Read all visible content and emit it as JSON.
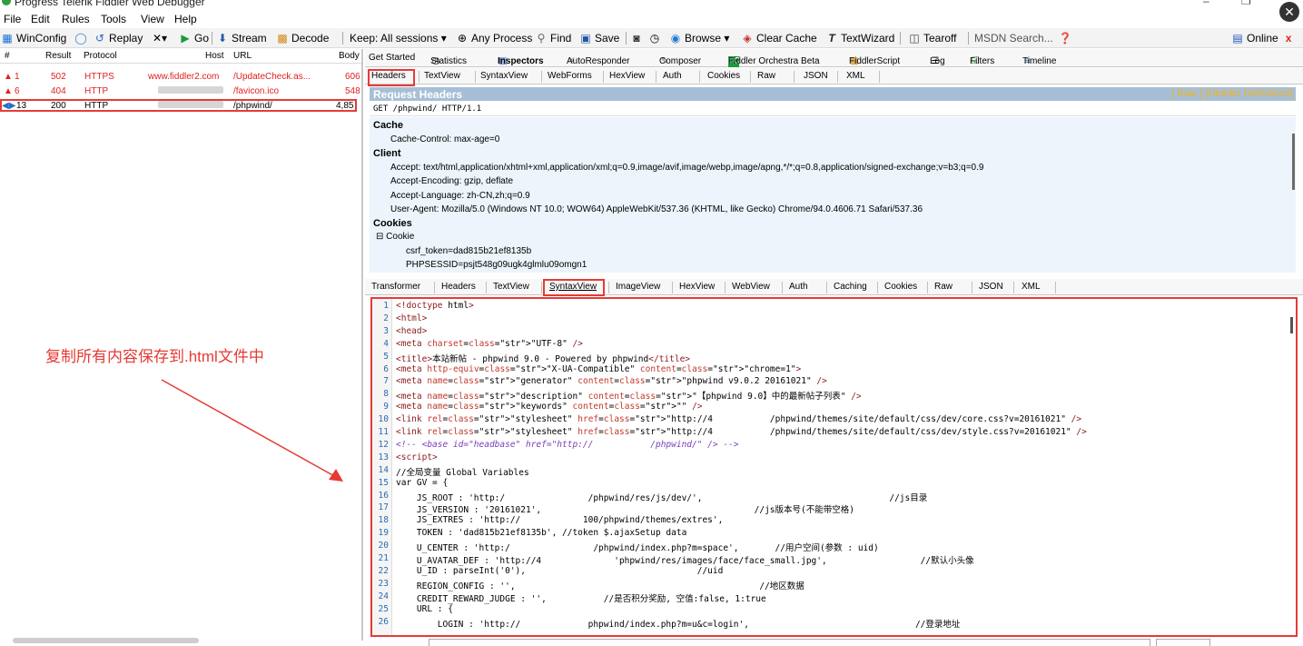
{
  "window": {
    "title": "Progress Telerik Fiddler Web Debugger",
    "close_glyph": "✕"
  },
  "menu": [
    "File",
    "Edit",
    "Rules",
    "Tools",
    "View",
    "Help"
  ],
  "toolbar": {
    "winconfig": "WinConfig",
    "replay": "Replay",
    "remove": "✕▾",
    "go": "Go",
    "stream": "Stream",
    "decode": "Decode",
    "keep": "Keep: All sessions ▾",
    "any_process": "Any Process",
    "find": "Find",
    "save": "Save",
    "browse": "Browse ▾",
    "clear_cache": "Clear Cache",
    "textwizard": "TextWizard",
    "tearoff": "Tearoff",
    "msdn": "MSDN Search...",
    "online": "Online",
    "online_close": "x"
  },
  "sessions": {
    "columns": [
      "#",
      "Result",
      "Protocol",
      "Host",
      "URL",
      "Body"
    ],
    "rows": [
      {
        "id": "1",
        "result": "502",
        "protocol": "HTTPS",
        "host": "www.fiddler2.com",
        "url": "/UpdateCheck.as...",
        "body": "606",
        "status": "error"
      },
      {
        "id": "6",
        "result": "404",
        "protocol": "HTTP",
        "host": "",
        "url": "/favicon.ico",
        "body": "548",
        "status": "error"
      },
      {
        "id": "13",
        "result": "200",
        "protocol": "HTTP",
        "host": "",
        "url": "/phpwind/",
        "body": "4,85",
        "status": "selected"
      }
    ]
  },
  "annotation": "复制所有内容保存到.html文件中",
  "main_tabs": [
    "Get Started",
    "Statistics",
    "Inspectors",
    "AutoResponder",
    "Composer",
    "Fiddler Orchestra Beta",
    "FiddlerScript",
    "Log",
    "Filters",
    "Timeline"
  ],
  "request_tabs": [
    "Headers",
    "TextView",
    "SyntaxView",
    "WebForms",
    "HexView",
    "Auth",
    "Cookies",
    "Raw",
    "JSON",
    "XML"
  ],
  "request_headers": {
    "title": "Request Headers",
    "links": "[ Raw ]   [Header Definitions]",
    "request_line": "GET /phpwind/ HTTP/1.1",
    "groups": [
      {
        "name": "Cache",
        "items": [
          "Cache-Control: max-age=0"
        ]
      },
      {
        "name": "Client",
        "items": [
          "Accept: text/html,application/xhtml+xml,application/xml;q=0.9,image/avif,image/webp,image/apng,*/*;q=0.8,application/signed-exchange;v=b3;q=0.9",
          "Accept-Encoding: gzip, deflate",
          "Accept-Language: zh-CN,zh;q=0.9",
          "User-Agent: Mozilla/5.0 (Windows NT 10.0; WOW64) AppleWebKit/537.36 (KHTML, like Gecko) Chrome/94.0.4606.71 Safari/537.36"
        ]
      },
      {
        "name": "Cookies",
        "items": [
          "Cookie"
        ]
      }
    ],
    "cookie_values": [
      "csrf_token=dad815b21ef8135b",
      "PHPSESSID=psjt548g09ugk4glmlu09omgn1"
    ]
  },
  "response_tabs": [
    "Transformer",
    "Headers",
    "TextView",
    "SyntaxView",
    "ImageView",
    "HexView",
    "WebView",
    "Auth",
    "Caching",
    "Cookies",
    "Raw",
    "JSON",
    "XML"
  ],
  "code_lines": [
    {
      "n": "1",
      "t": "<!doctype html>"
    },
    {
      "n": "2",
      "t": "<html>"
    },
    {
      "n": "3",
      "t": "<head>"
    },
    {
      "n": "4",
      "t": "<meta charset=\"UTF-8\" />"
    },
    {
      "n": "5",
      "t": "<title>本站新帖 - phpwind 9.0 - Powered by phpwind</title>"
    },
    {
      "n": "6",
      "t": "<meta http-equiv=\"X-UA-Compatible\" content=\"chrome=1\">"
    },
    {
      "n": "7",
      "t": "<meta name=\"generator\" content=\"phpwind v9.0.2 20161021\" />"
    },
    {
      "n": "8",
      "t": "<meta name=\"description\" content=\"【phpwind 9.0】中的最新帖子列表\" />"
    },
    {
      "n": "9",
      "t": "<meta name=\"keywords\" content=\"\" />"
    },
    {
      "n": "10",
      "t": "<link rel=\"stylesheet\" href=\"http://4           /phpwind/themes/site/default/css/dev/core.css?v=20161021\" />"
    },
    {
      "n": "11",
      "t": "<link rel=\"stylesheet\" href=\"http://4           /phpwind/themes/site/default/css/dev/style.css?v=20161021\" />"
    },
    {
      "n": "12",
      "t": "<!-- <base id=\"headbase\" href=\"http://           /phpwind/\" /> -->"
    },
    {
      "n": "13",
      "t": "<script>"
    },
    {
      "n": "14",
      "t": "//全局变量 Global Variables"
    },
    {
      "n": "15",
      "t": "var GV = {"
    },
    {
      "n": "16",
      "t": "    JS_ROOT : 'http:/                /phpwind/res/js/dev/',                                    //js目录"
    },
    {
      "n": "17",
      "t": "    JS_VERSION : '20161021',                                         //js版本号(不能带空格)"
    },
    {
      "n": "18",
      "t": "    JS_EXTRES : 'http://            100/phpwind/themes/extres',"
    },
    {
      "n": "19",
      "t": "    TOKEN : 'dad815b21ef8135b', //token $.ajaxSetup data"
    },
    {
      "n": "20",
      "t": "    U_CENTER : 'http:/                /phpwind/index.php?m=space',       //用户空间(参数 : uid)"
    },
    {
      "n": "21",
      "t": "    U_AVATAR_DEF : 'http://4              'phpwind/res/images/face/face_small.jpg',                  //默认小头像"
    },
    {
      "n": "22",
      "t": "    U_ID : parseInt('0'),                                 //uid"
    },
    {
      "n": "23",
      "t": "    REGION_CONFIG : '',                                               //地区数据"
    },
    {
      "n": "24",
      "t": "    CREDIT_REWARD_JUDGE : '',           //是否积分奖励, 空值:false, 1:true"
    },
    {
      "n": "25",
      "t": "    URL : {"
    },
    {
      "n": "26",
      "t": "        LOGIN : 'http://             phpwind/index.php?m=u&c=login',                                //登录地址"
    }
  ]
}
